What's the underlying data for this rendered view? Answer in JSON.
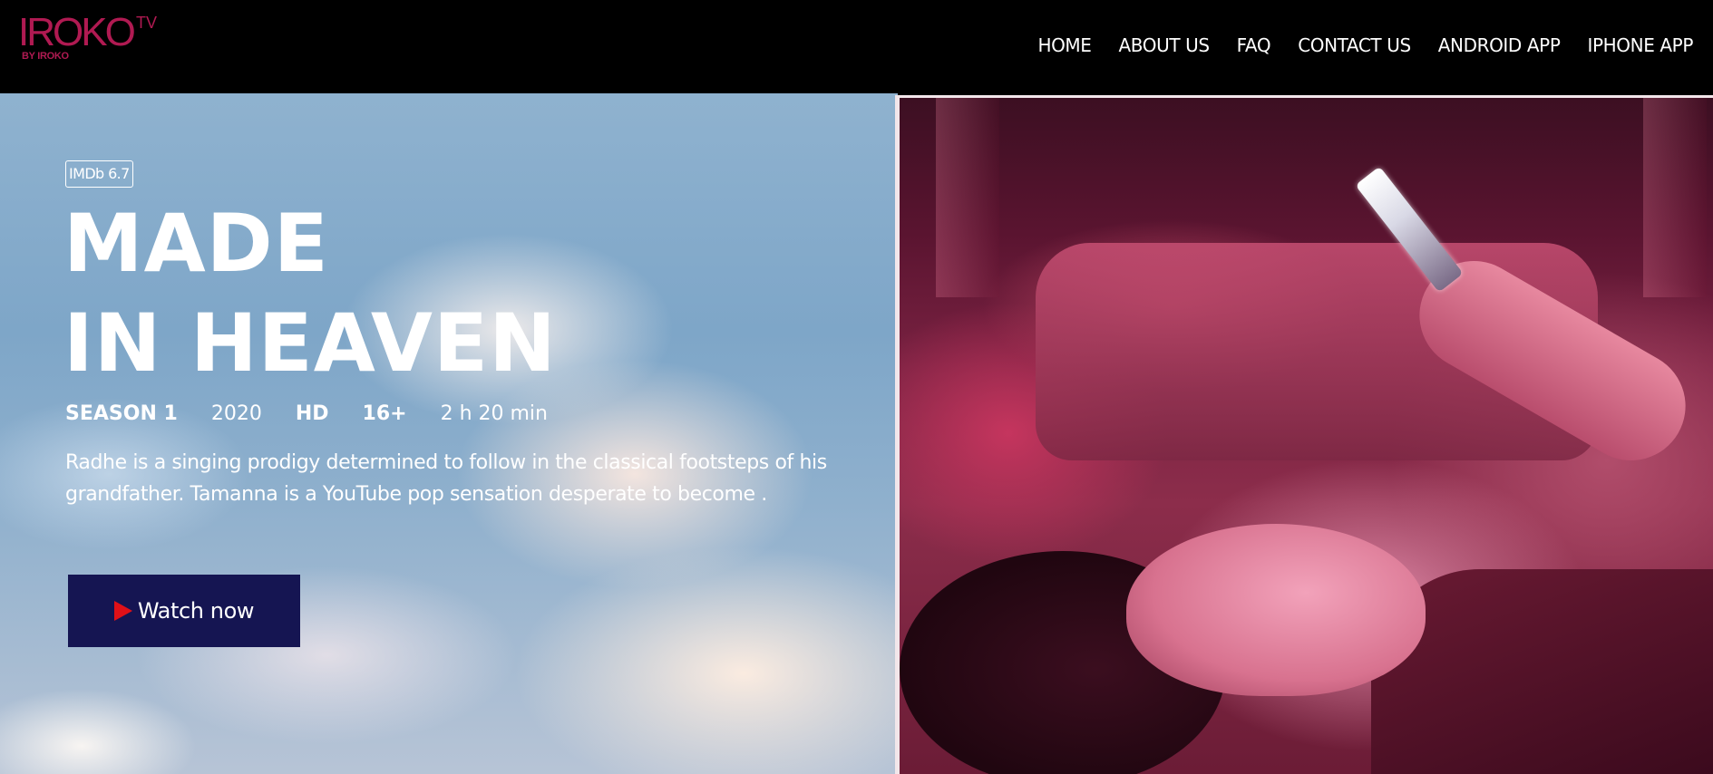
{
  "brand": {
    "logo_text": "IROKO",
    "logo_tv": "TV",
    "logo_sub": "BY IROKO",
    "color": "#b01a52"
  },
  "nav": {
    "items": [
      {
        "label": "HOME"
      },
      {
        "label": "ABOUT US"
      },
      {
        "label": "FAQ"
      },
      {
        "label": "CONTACT US"
      },
      {
        "label": "ANDROID APP"
      },
      {
        "label": "IPHONE APP"
      }
    ]
  },
  "hero": {
    "imdb_badge": "IMDb 6.7",
    "title_line1": "MADE",
    "title_line2": "IN HEAVEN",
    "meta": {
      "season": "SEASON 1",
      "year": "2020",
      "quality": "HD",
      "rating": "16+",
      "duration": "2 h 20 min"
    },
    "description": "Radhe is a singing prodigy determined to follow in the classical footsteps of his grandfather. Tamanna is a YouTube pop sensation desperate to become .",
    "watch_label": "Watch now",
    "play_icon": "play-icon",
    "button_color": "#151552",
    "play_color": "#e01018"
  }
}
